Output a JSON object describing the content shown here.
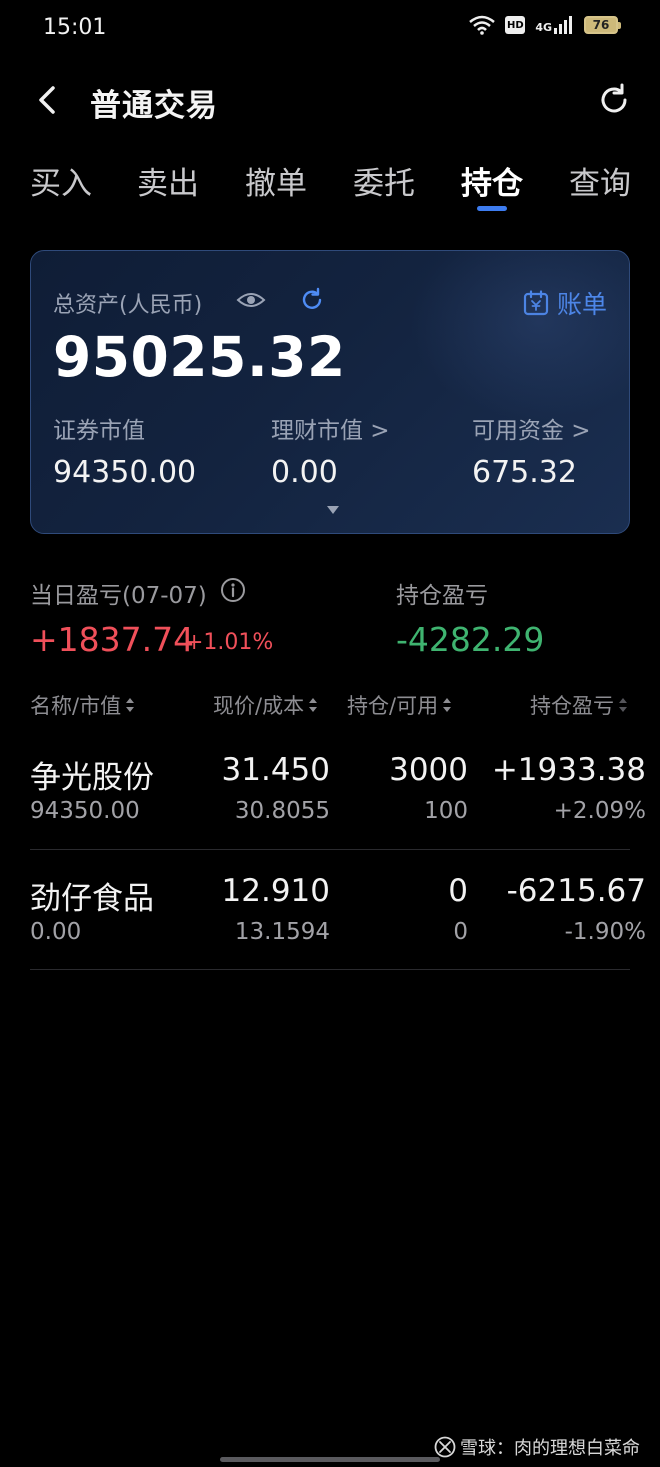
{
  "status": {
    "time": "15:01",
    "hd": "HD",
    "net": "4G",
    "battery": "76"
  },
  "header": {
    "title": "普通交易"
  },
  "tabs": [
    "买入",
    "卖出",
    "撤单",
    "委托",
    "持仓",
    "查询"
  ],
  "active_tab": "持仓",
  "assets": {
    "label": "总资产(人民币)",
    "bill_label": "账单",
    "total": "95025.32",
    "securities_label": "证券市值",
    "securities_value": "94350.00",
    "wealth_label": "理财市值 >",
    "wealth_value": "0.00",
    "cash_label": "可用资金 >",
    "cash_value": "675.32"
  },
  "pl": {
    "daily_label": "当日盈亏(07-07)",
    "daily_value": "+1837.74",
    "daily_pct": "+1.01%",
    "position_label": "持仓盈亏",
    "position_value": "-4282.29"
  },
  "table": {
    "headers": {
      "name": "名称/市值",
      "price": "现价/成本",
      "qty": "持仓/可用",
      "pl": "持仓盈亏"
    },
    "rows": [
      {
        "name": "争光股份",
        "market_value": "94350.00",
        "price": "31.450",
        "cost": "30.8055",
        "qty": "3000",
        "available": "100",
        "pl": "+1933.38",
        "pl_pct": "+2.09%"
      },
      {
        "name": "劲仔食品",
        "market_value": "0.00",
        "price": "12.910",
        "cost": "13.1594",
        "qty": "0",
        "available": "0",
        "pl": "-6215.67",
        "pl_pct": "-1.90%"
      }
    ]
  },
  "watermark": "雪球：肉的理想白菜命",
  "colors": {
    "accent": "#3d7cf0",
    "up": "#f0505a",
    "down": "#3fb470",
    "background": "#000000"
  }
}
